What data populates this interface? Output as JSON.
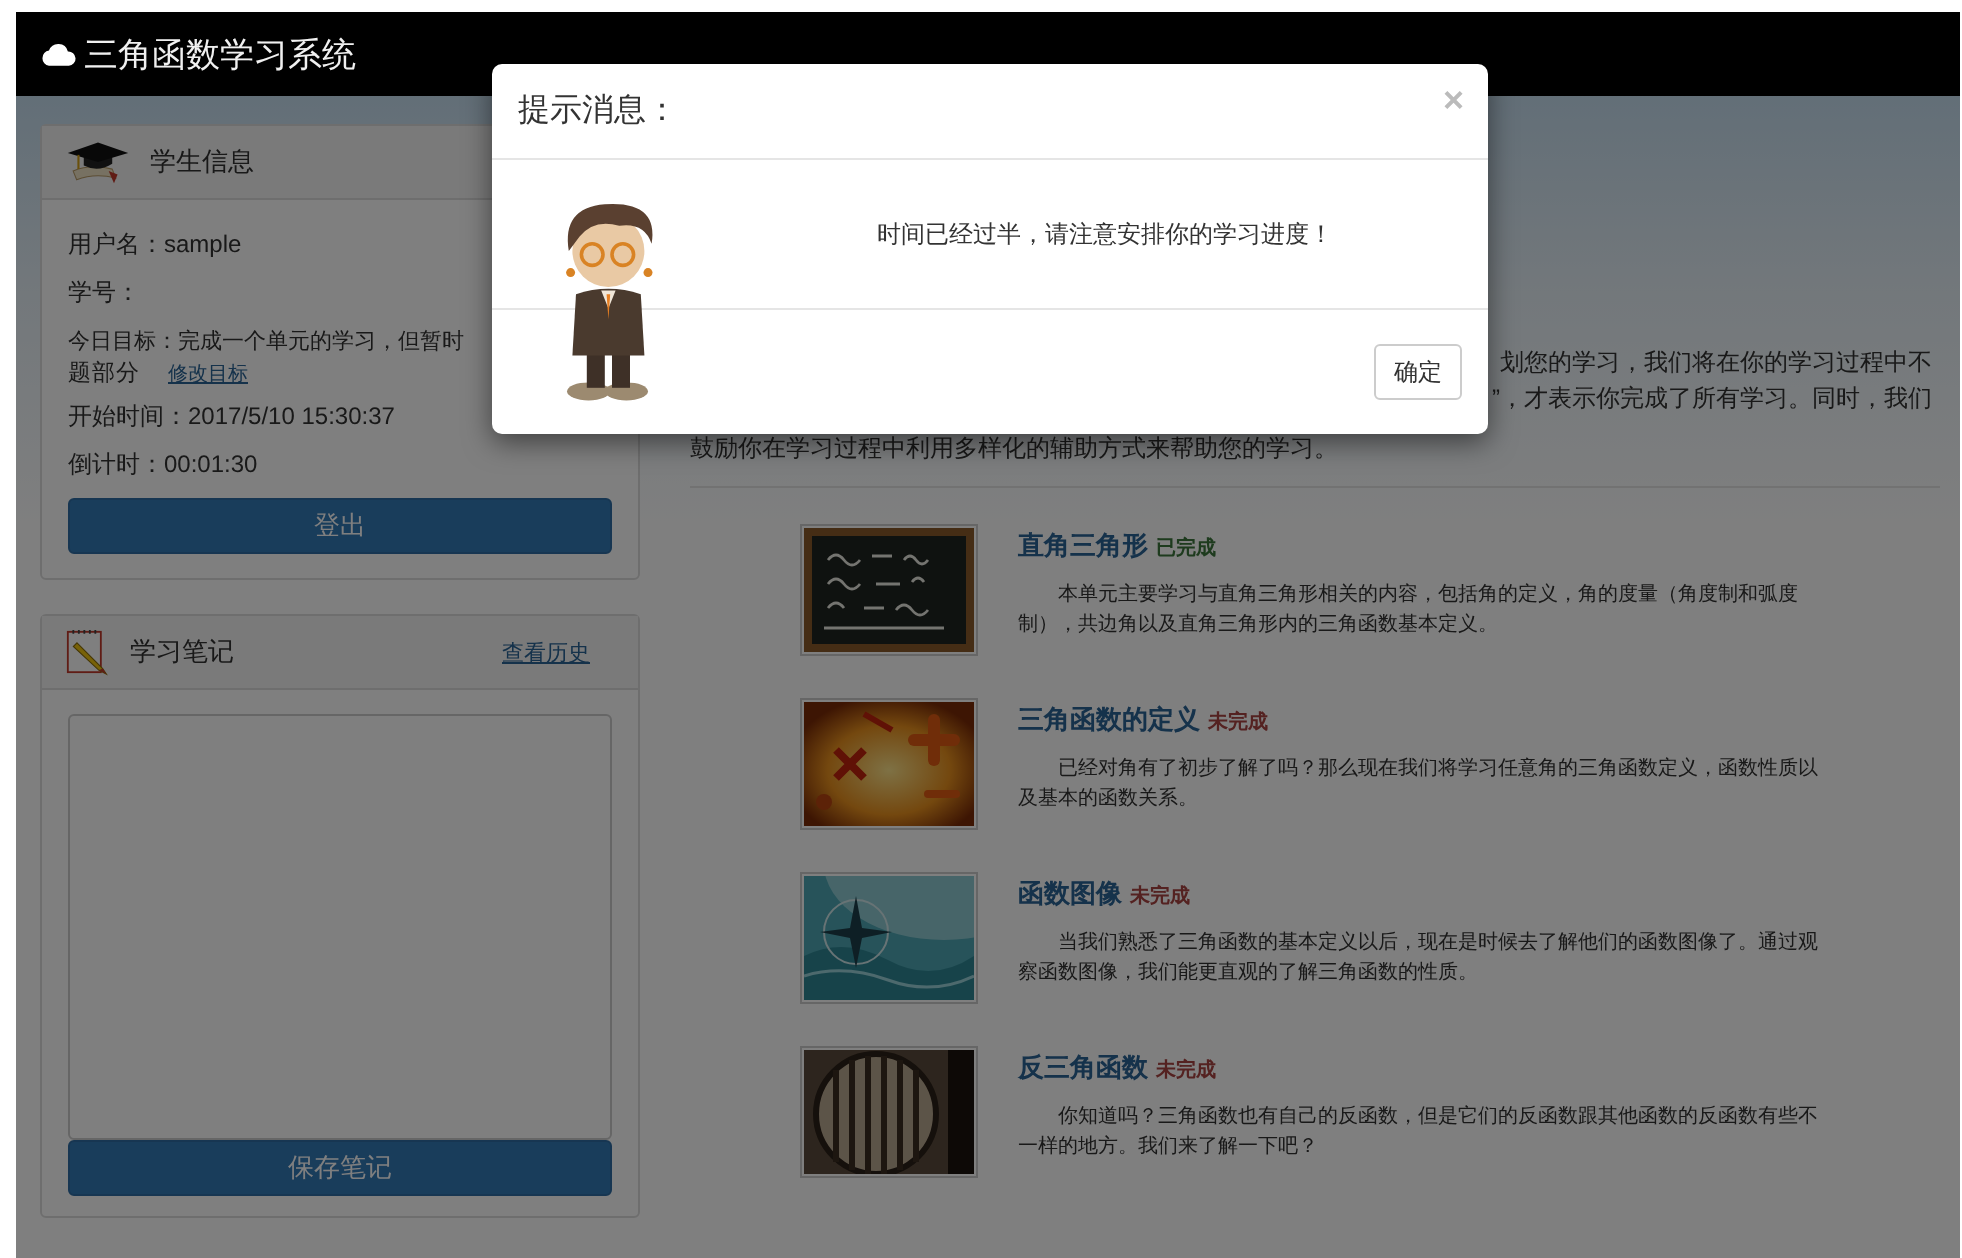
{
  "navbar": {
    "title": "三角函数学习系统"
  },
  "student_panel": {
    "title": "学生信息",
    "username": "用户名：sample",
    "student_id": "学号：",
    "goal_lines": [
      "今日目标：完成一个单元的学习，但暂时",
      "题部分"
    ],
    "edit_goal_link": "修改目标",
    "start_time": "开始时间：2017/5/10 15:30:37",
    "countdown": "倒计时：00:01:30",
    "logout_button": "登出"
  },
  "notes_panel": {
    "title": "学习笔记",
    "history_link": "查看历史",
    "save_button": "保存笔记"
  },
  "intro_lines": [
    {
      "text": "划您的学习，我们将在你的学习过程中不",
      "kind": "partial"
    },
    {
      "text": "”，才表示你完成了所有学习。同时，我们",
      "kind": "partial"
    },
    {
      "text": "鼓励你在学习过程中利用多样化的辅助方式来帮助您的学习。",
      "kind": "full"
    }
  ],
  "units": [
    {
      "title": "直角三角形",
      "status": "已完成",
      "completed": true,
      "description": "本单元主要学习与直角三角形相关的内容，包括角的定义，角的度量（角度制和弧度制），共边角以及直角三角形内的三角函数基本定义。"
    },
    {
      "title": "三角函数的定义",
      "status": "未完成",
      "completed": false,
      "description": "已经对角有了初步了解了吗？那么现在我们将学习任意角的三角函数定义，函数性质以及基本的函数关系。"
    },
    {
      "title": "函数图像",
      "status": "未完成",
      "completed": false,
      "description": "当我们熟悉了三角函数的基本定义以后，现在是时候去了解他们的函数图像了。通过观察函数图像，我们能更直观的了解三角函数的性质。"
    },
    {
      "title": "反三角函数",
      "status": "未完成",
      "completed": false,
      "description": "你知道吗？三角函数也有自己的反函数，但是它们的反函数跟其他函数的反函数有些不一样的地方。我们来了解一下吧？"
    }
  ],
  "modal": {
    "title": "提示消息：",
    "close": "×",
    "message": "时间已经过半，请注意安排你的学习进度！",
    "ok_button": "确定"
  }
}
